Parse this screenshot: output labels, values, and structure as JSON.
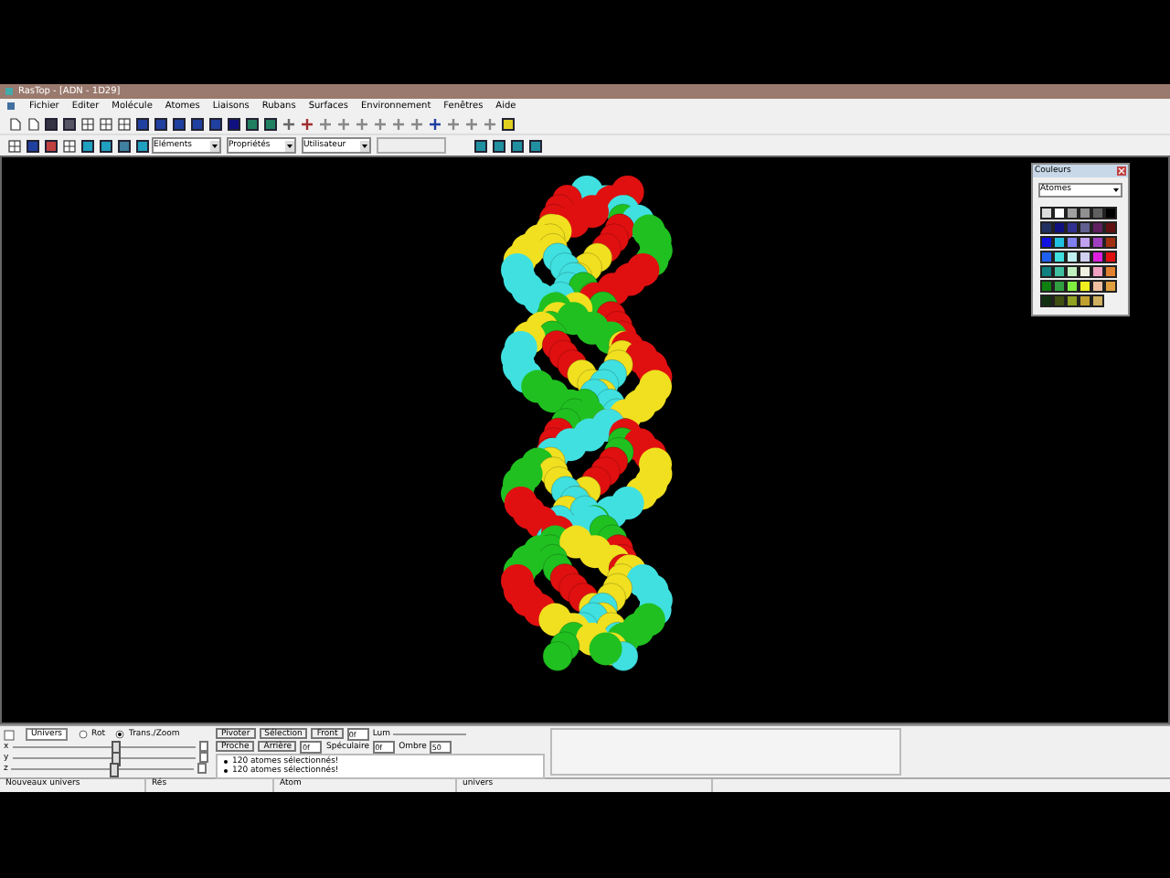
{
  "window": {
    "title": "RasTop - [ADN - 1D29]"
  },
  "menu": [
    "Fichier",
    "Editer",
    "Molécule",
    "Atomes",
    "Liaisons",
    "Rubans",
    "Surfaces",
    "Environnement",
    "Fenêtres",
    "Aide"
  ],
  "toolbar2": {
    "dropdowns": [
      "Eléments",
      "Propriétés",
      "Utilisateur"
    ]
  },
  "colors_window": {
    "title": "Couleurs",
    "dropdown": "Atomes",
    "palette": [
      {
        "color": "#dcdcdc"
      },
      {
        "color": "#ffffff"
      },
      {
        "color": "#a0a0a0"
      },
      {
        "color": "#909090"
      },
      {
        "color": "#606060"
      },
      {
        "color": "#000000"
      },
      {
        "color": "#203060"
      },
      {
        "color": "#101080"
      },
      {
        "color": "#303090"
      },
      {
        "color": "#606090"
      },
      {
        "color": "#602060"
      },
      {
        "color": "#601010"
      },
      {
        "color": "#1010e0"
      },
      {
        "color": "#20c0e0"
      },
      {
        "color": "#8080f0"
      },
      {
        "color": "#c0a0f0"
      },
      {
        "color": "#a040c0"
      },
      {
        "color": "#a03010"
      },
      {
        "color": "#2060f0"
      },
      {
        "color": "#40e0e0"
      },
      {
        "color": "#c0f0f0"
      },
      {
        "color": "#d0d0f0"
      },
      {
        "color": "#e020e0"
      },
      {
        "color": "#e01010"
      },
      {
        "color": "#108080"
      },
      {
        "color": "#40c0a0"
      },
      {
        "color": "#c0f0c0"
      },
      {
        "color": "#f0f0e0"
      },
      {
        "color": "#f0a0c0"
      },
      {
        "color": "#e08030"
      },
      {
        "color": "#108010"
      },
      {
        "color": "#30a040"
      },
      {
        "color": "#80f040"
      },
      {
        "color": "#f0f020"
      },
      {
        "color": "#f0c0a0"
      },
      {
        "color": "#e0a040"
      },
      {
        "color": "#103010"
      },
      {
        "color": "#405010"
      },
      {
        "color": "#90a020"
      },
      {
        "color": "#c0a030"
      },
      {
        "color": "#d0b060"
      }
    ]
  },
  "panel": {
    "mode_button": "Univers",
    "radios": [
      {
        "label": "Rot",
        "selected": false
      },
      {
        "label": "Trans./Zoom",
        "selected": true
      }
    ],
    "sliders": [
      {
        "name": "x",
        "level": 0.55
      },
      {
        "name": "y",
        "level": 0.55
      },
      {
        "name": "z",
        "level": 0.55
      }
    ],
    "buttons": [
      "Pivoter",
      "Sélection",
      "Front",
      "Proche",
      "Arrière"
    ],
    "fields": [
      "0f",
      "0f"
    ],
    "messages": [
      "120 atomes sélectionnés!",
      "120 atomes sélectionnés!"
    ],
    "light": {
      "lum": "Lum",
      "speculaire": "Spéculaire",
      "spec_value": "0f",
      "ombre": "Ombre",
      "ombre_value": "50"
    }
  },
  "status_bar": [
    "Nouveaux univers",
    "Rés",
    "Atom",
    "univers"
  ]
}
